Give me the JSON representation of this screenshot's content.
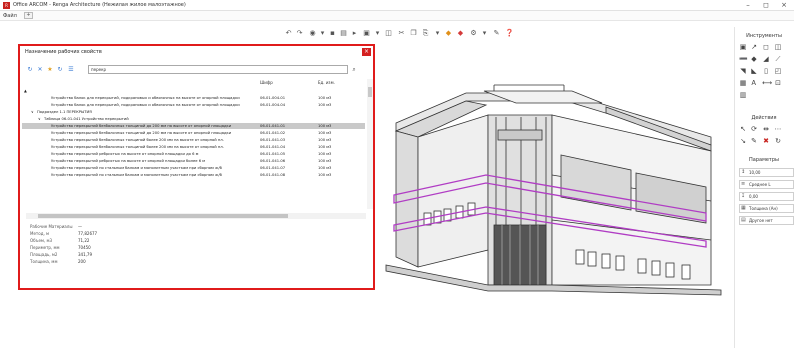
{
  "window": {
    "title": "Office ARCOM - Renga Architecture (Нежилая жилое малоэтажное)",
    "controls": [
      "–",
      "◻",
      "×"
    ]
  },
  "menu": {
    "file_label": "Файл",
    "add_label": "+"
  },
  "dialog": {
    "title": "Назначение рабочих свойств",
    "close_label": "×",
    "search": {
      "value": "перекр"
    },
    "columns": {
      "name": "",
      "code": "Шифр",
      "unit": "Ед. изм."
    },
    "rows": [
      {
        "indent": 0,
        "toggle": "▲",
        "name": "",
        "code": "",
        "unit": "",
        "selected": false
      },
      {
        "indent": 3,
        "toggle": "",
        "name": "Устройство балок для перекрытий, подкрановых и обвязочных на высоте от опорной площадки",
        "code": "06-01-004-01",
        "unit": "100 м3",
        "selected": false
      },
      {
        "indent": 3,
        "toggle": "",
        "name": "Устройство балок для перекрытий, подкрановых и обвязочных на высоте от опорной площадки",
        "code": "06-01-004-04",
        "unit": "100 м3",
        "selected": false
      },
      {
        "indent": 1,
        "toggle": "∨",
        "name": "Подраздел 1.1 ПЕРЕКРЫТИЯ",
        "code": "",
        "unit": "",
        "selected": false
      },
      {
        "indent": 2,
        "toggle": "∨",
        "name": "Таблица 06-01-041 Устройство перекрытий",
        "code": "",
        "unit": "",
        "selected": false
      },
      {
        "indent": 3,
        "toggle": "",
        "name": "Устройство перекрытий безбалочных толщиной до 200 мм на высоте от опорной площадки",
        "code": "06-01-041-01",
        "unit": "100 м3",
        "selected": true
      },
      {
        "indent": 3,
        "toggle": "",
        "name": "Устройство перекрытий безбалочных толщиной до 200 мм на высоте от опорной площадки",
        "code": "06-01-041-02",
        "unit": "100 м3",
        "selected": false
      },
      {
        "indent": 3,
        "toggle": "",
        "name": "Устройство перекрытий безбалочных толщиной более 200 мм на высоте от опорной пл.",
        "code": "06-01-041-03",
        "unit": "100 м3",
        "selected": false
      },
      {
        "indent": 3,
        "toggle": "",
        "name": "Устройство перекрытий безбалочных толщиной более 200 мм на высоте от опорной пл.",
        "code": "06-01-041-04",
        "unit": "100 м3",
        "selected": false
      },
      {
        "indent": 3,
        "toggle": "",
        "name": "Устройство перекрытий ребристых на высоте от опорной площадки до 6 м",
        "code": "06-01-041-05",
        "unit": "100 м3",
        "selected": false
      },
      {
        "indent": 3,
        "toggle": "",
        "name": "Устройство перекрытий ребристых на высоте от опорной площадки более 6 м",
        "code": "06-01-041-06",
        "unit": "100 м3",
        "selected": false
      },
      {
        "indent": 3,
        "toggle": "",
        "name": "Устройство перекрытий по стальным балкам и монолитным участкам при сборном ж/б",
        "code": "06-01-041-07",
        "unit": "100 м3",
        "selected": false
      },
      {
        "indent": 3,
        "toggle": "",
        "name": "Устройство перекрытий по стальным балкам и монолитным участкам при сборном ж/б",
        "code": "06-01-041-08",
        "unit": "100 м3",
        "selected": false
      }
    ],
    "properties": [
      {
        "key": "Рабочие Материалы",
        "value": "—"
      },
      {
        "key": "Метод, м",
        "value": "77,82677"
      },
      {
        "key": "Объем, м3",
        "value": "71,22"
      },
      {
        "key": "Периметр, мм",
        "value": "70450"
      },
      {
        "key": "Площадь, м2",
        "value": "341,79"
      },
      {
        "key": "Толщина, мм",
        "value": "200"
      }
    ]
  },
  "right_panel": {
    "instruments_title": "Инструменты",
    "actions_title": "Действия",
    "params_title": "Параметры",
    "params": [
      {
        "icon": "↕",
        "value": "10,00"
      },
      {
        "icon": "≡",
        "value": "Среднее L"
      },
      {
        "icon": "↧",
        "value": "0,00"
      },
      {
        "icon": "▦",
        "value": "Толщина (Ан)"
      },
      {
        "icon": "▤",
        "value": "Другое нет"
      }
    ]
  },
  "colors": {
    "dialog_border": "#e01b1b",
    "selection": "#c9c9c9",
    "highlight_purple": "#b03cc4"
  },
  "icons": [
    "renga-logo-icon",
    "undo-icon",
    "redo-icon",
    "save-icon",
    "search-icon",
    "close-icon",
    "filter-icon",
    "pencil-icon",
    "help-icon"
  ]
}
